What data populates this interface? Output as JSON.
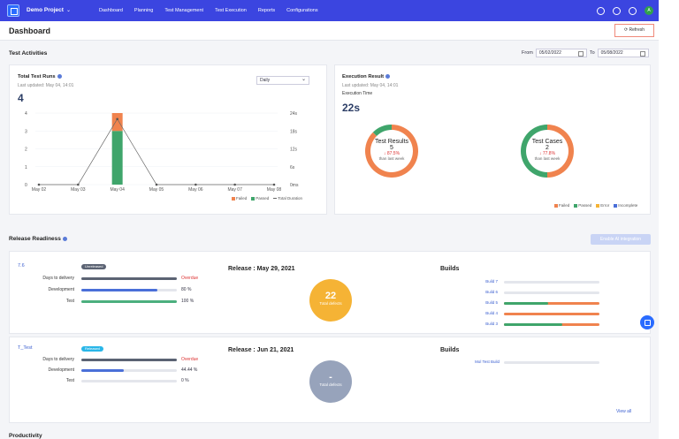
{
  "nav": {
    "project": "Demo Project",
    "links": [
      "Dashboard",
      "Planning",
      "Test Management",
      "Test Execution",
      "Reports",
      "Configurations"
    ],
    "avatar": "A"
  },
  "header": {
    "title": "Dashboard",
    "refresh": "Refresh"
  },
  "test_activities": {
    "title": "Test Activities",
    "from_label": "From",
    "from_date": "05/02/2022",
    "to_label": "To",
    "to_date": "05/08/2022"
  },
  "total_runs": {
    "title": "Total Test Runs",
    "updated": "Last updated: May 04, 14:01",
    "count": "4",
    "interval": "Daily",
    "legend": [
      "Failed",
      "Passed",
      "Total Duration"
    ]
  },
  "execution_result": {
    "title": "Execution Result",
    "updated": "Last updated: May 04, 14:01",
    "time_label": "Execution Time",
    "time_value": "22s",
    "donut1": {
      "title": "Test Results",
      "count": "5",
      "change": "↓ 87.5%",
      "sub": "than last week"
    },
    "donut2": {
      "title": "Test Cases",
      "count": "2",
      "change": "↓ 77.8%",
      "sub": "than last week"
    },
    "legend": [
      "Failed",
      "Passed",
      "Error",
      "Incomplete"
    ]
  },
  "release_readiness": {
    "title": "Release Readiness",
    "enable_btn": "Enable AI integration",
    "releases": [
      {
        "name": "7.6",
        "badge": "Unreleased",
        "date": "Release : May 29, 2021",
        "metrics": [
          {
            "label": "Days to delivery",
            "value": "Overdue",
            "fill": 1.0,
            "color": "#5b6373"
          },
          {
            "label": "Development",
            "value": "80 %",
            "fill": 0.8,
            "color": "#4a6fd8"
          },
          {
            "label": "Test",
            "value": "100 %",
            "fill": 1.0,
            "color": "#4caf7e"
          }
        ],
        "defects": "22",
        "defects_label": "Total defects",
        "builds_title": "Builds",
        "builds": [
          "Build 7",
          "Build 6",
          "Build 5",
          "Build 4",
          "Build 3"
        ]
      },
      {
        "name": "T_Test",
        "badge": "Released",
        "date": "Release : Jun 21, 2021",
        "metrics": [
          {
            "label": "Days to delivery",
            "value": "Overdue",
            "fill": 1.0,
            "color": "#5b6373"
          },
          {
            "label": "Development",
            "value": "44.44 %",
            "fill": 0.44,
            "color": "#4a6fd8"
          },
          {
            "label": "Test",
            "value": "0 %",
            "fill": 0.0,
            "color": "#4caf7e"
          }
        ],
        "defects": "-",
        "defects_label": "Total defects",
        "builds_title": "Builds",
        "builds": [
          "Mol Test Build"
        ]
      }
    ],
    "view_all": "View all"
  },
  "productivity": {
    "title": "Productivity"
  },
  "colors": {
    "failed": "#f0834e",
    "passed": "#3fa56b",
    "error": "#f5b335",
    "incomplete": "#4a6fd8"
  },
  "chart_data": [
    {
      "type": "bar",
      "title": "Total Test Runs",
      "categories": [
        "May 02",
        "May 03",
        "May 04",
        "May 05",
        "May 06",
        "May 07",
        "May 08"
      ],
      "series": [
        {
          "name": "Failed",
          "values": [
            0,
            0,
            1,
            0,
            0,
            0,
            0
          ]
        },
        {
          "name": "Passed",
          "values": [
            0,
            0,
            3,
            0,
            0,
            0,
            0
          ]
        },
        {
          "name": "Total Duration",
          "values": [
            0,
            0,
            22,
            0,
            0,
            0,
            0
          ]
        }
      ],
      "yticks_left": [
        "0",
        "1",
        "2",
        "3",
        "4"
      ],
      "yticks_right": [
        "0ms",
        "6s",
        "12s",
        "18s",
        "24s"
      ],
      "ylim": [
        0,
        4
      ],
      "ylim_right": [
        0,
        24
      ],
      "legend_position": "bottom-right"
    },
    {
      "type": "pie",
      "title": "Test Results",
      "labels": [
        "Failed",
        "Passed"
      ],
      "values": [
        87.5,
        12.5
      ]
    },
    {
      "type": "pie",
      "title": "Test Cases",
      "labels": [
        "Failed",
        "Passed"
      ],
      "values": [
        50,
        50
      ]
    }
  ]
}
